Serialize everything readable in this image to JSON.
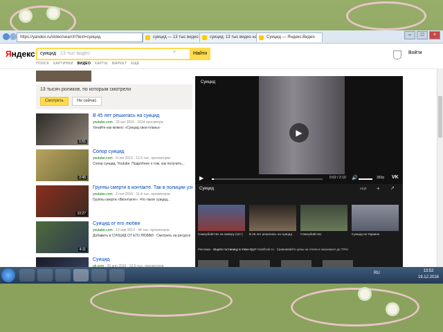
{
  "browser": {
    "url": "https://yandex.ru/video/search?text=суицид",
    "tabs": [
      {
        "label": "суицид — 13 тыс видео на..."
      },
      {
        "label": "суицид: 13 тыс видео на..."
      },
      {
        "label": "Суицид — Яндекс.Видео"
      }
    ],
    "window_controls": {
      "minimize": "–",
      "maximize": "□",
      "close": "×"
    }
  },
  "header": {
    "logo": "Яндекс",
    "logo_first": "Я",
    "logo_rest": "ндекс",
    "search": {
      "value": "суицид",
      "placeholder": "13 тыс видео"
    },
    "search_button": "Найти",
    "clear": "×",
    "services": [
      "ПОИСК",
      "КАРТИНКИ",
      "ВИДЕО",
      "КАРТЫ",
      "МАРКЕТ",
      "ЕЩЁ"
    ],
    "login": "Войти"
  },
  "results": {
    "filter_title": "13 тысяч роликов, по которым смотрели",
    "filter_buttons": [
      "Смотреть",
      "Не сейчас"
    ],
    "items": [
      {
        "title": "В 45 лет решилась на суицид",
        "source": "youtube.com",
        "meta": "29 окт 2015 · 1624 просмотра",
        "desc": "Узнайте как можно: «Суицид свои планы»",
        "duration": "1:51"
      },
      {
        "title": "Сопор суицид",
        "source": "youtube.com",
        "meta": "9 сен 2013 · 12,5 тыс. просмотров",
        "desc": "Сопор суицид. Youtube. Подробнее о том, как получить...",
        "duration": "2:45"
      },
      {
        "title": "Группы смерти в контакте. Так в полиции узнали...",
        "source": "youtube.com",
        "meta": "2 ноя 2016 · 11,4 тыс. просмотров",
        "desc": "Группы смерти «Вконтакте». Что такое суицид...",
        "duration": "10:27"
      },
      {
        "title": "Суицид от его любви",
        "source": "youtube.com",
        "meta": "13 апр 2012 · 44 тыс. просмотров",
        "desc": "Добавить в СУИЦИД ОТ ЕГО ЛЮБВИ · Смотреть на ресурсе",
        "duration": "4:11"
      },
      {
        "title": "Суицид",
        "source": "ok.com",
        "meta": "26 апр 2016 · 12,5 тыс. просмотров",
        "desc": "",
        "duration": ""
      }
    ]
  },
  "player": {
    "title": "Суицид",
    "play": "▶",
    "current_time": "0:02",
    "total_time": "2:10",
    "time_text": "0:02 / 2:10",
    "progress": 0.02,
    "quality": "360p",
    "vk": "VK"
  },
  "related": {
    "heading": "Суицид",
    "more": "ещё",
    "plus": "+",
    "share": "↗",
    "cards": [
      {
        "label": "Самоубийство на камеру (18+)"
      },
      {
        "label": "В 45 лет решилась на суицид"
      },
      {
        "label": "Самоубийство"
      },
      {
        "label": "Суицид на Украине"
      }
    ],
    "ad_label": "Реклама",
    "ad_title": "Ищите гостиницу в Улан-Удэ?",
    "ad_text": "Hotellook.ru · Сравнивайте цены на отели и экономьте до 70%!"
  },
  "taskbar": {
    "tray": "RU",
    "time": "13:52",
    "date": "19.12.2016"
  },
  "colors": {
    "yandex_yellow": "#ffdb4d",
    "link_blue": "#0044bb",
    "source_green": "#007700",
    "slide_green": "#8aa35e"
  }
}
